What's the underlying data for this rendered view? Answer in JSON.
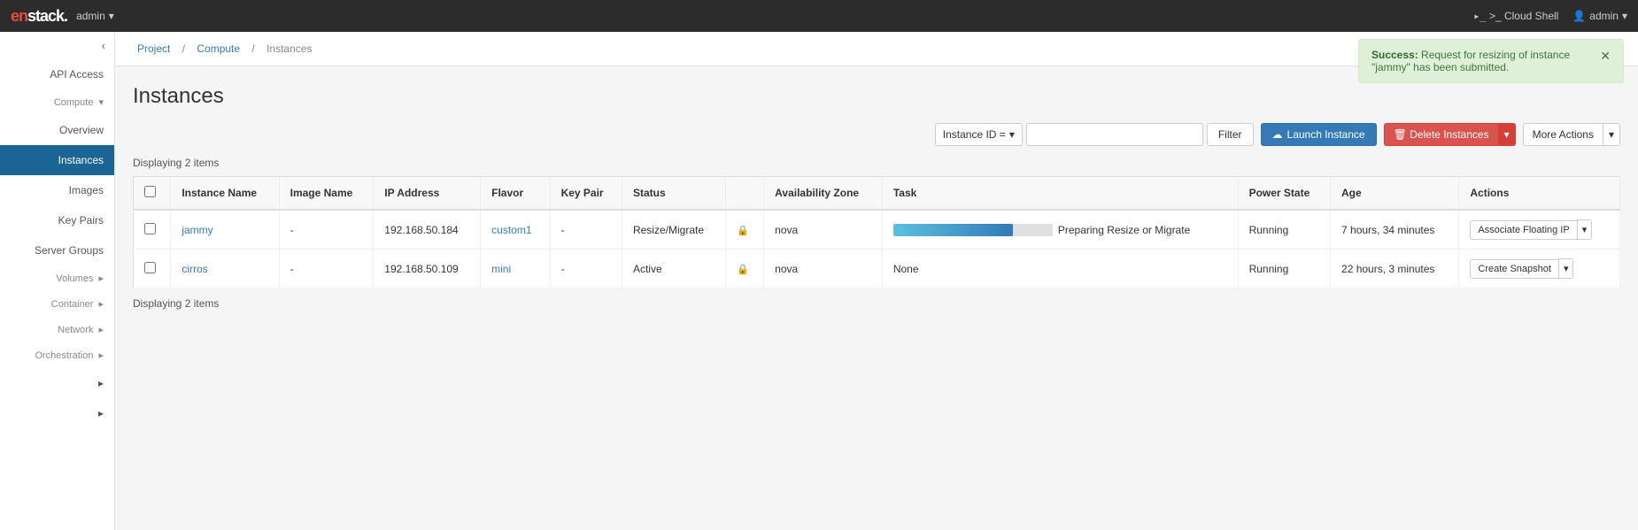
{
  "topbar": {
    "logo_text": "enstack.",
    "logo_highlight": "en",
    "admin_label": "admin",
    "cloud_shell_label": ">_ Cloud Shell",
    "user_label": "admin"
  },
  "sidebar": {
    "toggle_arrow": "‹",
    "api_access_label": "API Access",
    "compute_label": "Compute",
    "overview_label": "Overview",
    "instances_label": "Instances",
    "images_label": "Images",
    "key_pairs_label": "Key Pairs",
    "server_groups_label": "Server Groups",
    "volumes_label": "Volumes",
    "container_label": "Container",
    "network_label": "Network",
    "orchestration_label": "Orchestration",
    "expand1_label": "",
    "expand2_label": ""
  },
  "breadcrumb": {
    "project_label": "Project",
    "compute_label": "Compute",
    "instances_label": "Instances"
  },
  "page": {
    "title": "Instances",
    "displaying_text1": "Displaying 2 items",
    "displaying_text2": "Displaying 2 items"
  },
  "toolbar": {
    "filter_label": "Instance ID =",
    "filter_placeholder": "",
    "filter_button_label": "Filter",
    "launch_icon": "☁",
    "launch_label": "Launch Instance",
    "delete_label": "Delete Instances",
    "more_actions_label": "More Actions"
  },
  "table": {
    "headers": [
      "",
      "Instance Name",
      "Image Name",
      "IP Address",
      "Flavor",
      "Key Pair",
      "Status",
      "",
      "Availability Zone",
      "Task",
      "Power State",
      "Age",
      "Actions"
    ],
    "rows": [
      {
        "id": "row1",
        "name": "jammy",
        "image_name": "-",
        "ip_address": "192.168.50.184",
        "flavor": "custom1",
        "key_pair": "-",
        "status": "Resize/Migrate",
        "lock": "🔒",
        "availability_zone": "nova",
        "task": "Preparing Resize or Migrate",
        "task_progress": 75,
        "power_state": "Running",
        "age": "7 hours, 34 minutes",
        "action_label": "Associate Floating IP"
      },
      {
        "id": "row2",
        "name": "cirros",
        "image_name": "-",
        "ip_address": "192.168.50.109",
        "flavor": "mini",
        "key_pair": "-",
        "status": "Active",
        "lock": "🔒",
        "availability_zone": "nova",
        "task": "None",
        "task_progress": 0,
        "power_state": "Running",
        "age": "22 hours, 3 minutes",
        "action_label": "Create Snapshot"
      }
    ]
  },
  "notification": {
    "type": "Success",
    "message": "Request for resizing of instance \"jammy\" has been submitted."
  }
}
